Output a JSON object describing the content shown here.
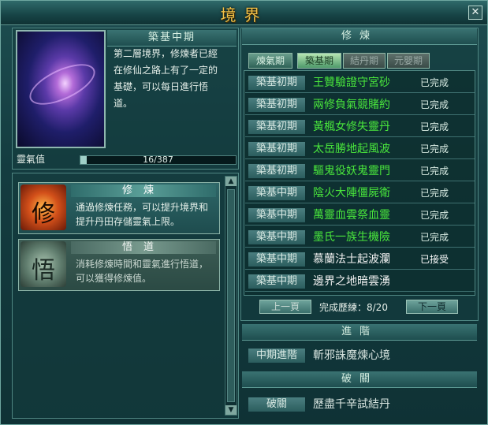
{
  "window": {
    "title": "境界",
    "close_glyph": "✕"
  },
  "realm": {
    "stage_name": "築基中期",
    "description": "第二層境界，修煉者已經在修仙之路上有了一定的基礎，可以每日進行悟道。",
    "spirit_label": "靈氣值",
    "spirit_value": "16/387",
    "spirit_fraction": 0.041
  },
  "actions": [
    {
      "name": "修煉",
      "icon_glyph": "修",
      "text": "通過修煉任務，可以提升境界和提升丹田存儲靈氣上限。"
    },
    {
      "name": "悟道",
      "icon_glyph": "悟",
      "text": "消耗修煉時間和靈氣進行悟道，可以獲得修煉值。"
    }
  ],
  "cultivation": {
    "header": "修煉",
    "tabs": [
      {
        "label": "煉氣期",
        "state": "normal"
      },
      {
        "label": "築基期",
        "state": "active"
      },
      {
        "label": "結丹期",
        "state": "disabled"
      },
      {
        "label": "元嬰期",
        "state": "disabled"
      }
    ],
    "quests": [
      {
        "stage": "築基初期",
        "name": "王贊驗證守宮砂",
        "status": "已完成",
        "done": true
      },
      {
        "stage": "築基初期",
        "name": "兩修負氣競賭約",
        "status": "已完成",
        "done": true
      },
      {
        "stage": "築基初期",
        "name": "黃楓女修失靈丹",
        "status": "已完成",
        "done": true
      },
      {
        "stage": "築基初期",
        "name": "太岳勝地起風波",
        "status": "已完成",
        "done": true
      },
      {
        "stage": "築基初期",
        "name": "驅鬼役妖鬼靈門",
        "status": "已完成",
        "done": true
      },
      {
        "stage": "築基中期",
        "name": "陰火大陣僵屍衛",
        "status": "已完成",
        "done": true
      },
      {
        "stage": "築基中期",
        "name": "萬靈血雲祭血靈",
        "status": "已完成",
        "done": true
      },
      {
        "stage": "築基中期",
        "name": "墨氏一族生機險",
        "status": "已完成",
        "done": true
      },
      {
        "stage": "築基中期",
        "name": "慕蘭法士起波瀾",
        "status": "已接受",
        "done": false
      },
      {
        "stage": "築基中期",
        "name": "邊界之地暗雲湧",
        "status": "",
        "done": false
      }
    ],
    "prev_label": "上一頁",
    "next_label": "下一頁",
    "progress_label": "完成歷練：8/20"
  },
  "advance": {
    "header": "進階",
    "stage": "中期進階",
    "name": "斬邪誅魔煉心境"
  },
  "breakthrough": {
    "header": "破關",
    "stage": "破關",
    "name": "歷盡千辛試結丹"
  },
  "colors": {
    "title_gold": "#f0c24a",
    "quest_done": "#49e63c",
    "status_done": "#d9ece4",
    "quest_pending": "#f0f0f0",
    "disabled_text": "#98a8a4"
  }
}
